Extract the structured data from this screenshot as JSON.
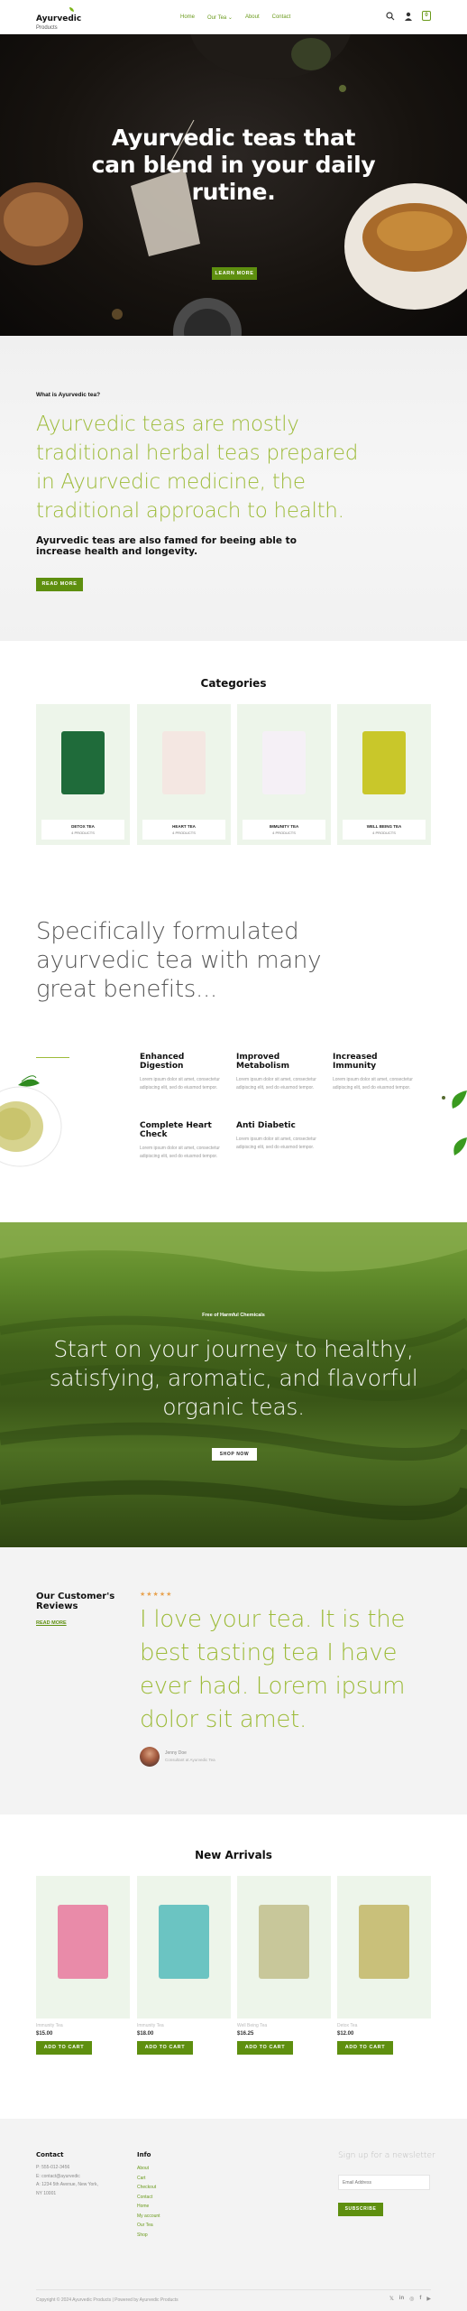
{
  "header": {
    "logo": "Ayurvedic",
    "logo_sub": "Products",
    "nav": [
      "Home",
      "Our Tea ⌄",
      "About",
      "Contact"
    ],
    "cart_count": "0"
  },
  "hero": {
    "title_lines": [
      "Ayurvedic teas that",
      "can blend in your daily",
      "rutine."
    ],
    "cta": "LEARN MORE"
  },
  "about": {
    "kicker": "What is Ayurvedic tea?",
    "headline_lines": [
      "Ayurvedic teas are mostly",
      "traditional herbal teas prepared",
      "in Ayurvedic medicine, the",
      "traditional approach to health."
    ],
    "subtitle_lines": [
      "Ayurvedic teas are also famed for beeing able to",
      "increase health and longevity."
    ],
    "cta": "READ MORE"
  },
  "categories": {
    "title": "Categories",
    "items": [
      {
        "name": "DETOX TEA",
        "count": "4 PRODUCTS",
        "color": "#1f6b3a"
      },
      {
        "name": "HEART TEA",
        "count": "4 PRODUCTS",
        "color": "#f4e7e2"
      },
      {
        "name": "IMMUNITY TEA",
        "count": "4 PRODUCTS",
        "color": "#f5f0f6"
      },
      {
        "name": "WELL BEING TEA",
        "count": "4 PRODUCTS",
        "color": "#c9c72a"
      }
    ]
  },
  "benefits": {
    "title_lines": [
      "Specifically formulated",
      "ayurvedic tea with many",
      "great benefits..."
    ],
    "items": [
      {
        "title": "Enhanced Digestion",
        "text": "Lorem ipsum dolor sit amet, consectetur adipiscing elit, sed do eiusmod tempor."
      },
      {
        "title": "Improved Metabolism",
        "text": "Lorem ipsum dolor sit amet, consectetur adipiscing elit, sed do eiusmod tempor."
      },
      {
        "title": "Increased Immunity",
        "text": "Lorem ipsum dolor sit amet, consectetur adipiscing elit, sed do eiusmod tempor."
      },
      {
        "title": "Complete Heart Check",
        "text": "Lorem ipsum dolor sit amet, consectetur adipiscing elit, sed do eiusmod tempor."
      },
      {
        "title": "Anti Diabetic",
        "text": "Lorem ipsum dolor sit amet, consectetur adipiscing elit, sed do eiusmod tempor."
      }
    ]
  },
  "journey": {
    "kicker": "Free of Harmful Chemicals",
    "title_lines": [
      "Start on your journey to healthy,",
      "satisfying, aromatic, and flavorful",
      "organic teas."
    ],
    "cta": "SHOP NOW"
  },
  "testimonial": {
    "section_title_lines": [
      "Our Customer's",
      "Reviews"
    ],
    "more_link": "READ MORE",
    "stars": "★★★★★",
    "quote_lines": [
      "I love your tea. It is the",
      "best tasting tea I have",
      "ever had. Lorem ipsum",
      "dolor sit amet."
    ],
    "name": "Jenny Doe",
    "role": "Consultant at Ayurvedic Tea"
  },
  "arrivals": {
    "title": "New Arrivals",
    "items": [
      {
        "category": "Immunity Tea",
        "price": "$15.00",
        "cta": "ADD TO CART",
        "color": "#e98ba9"
      },
      {
        "category": "Immunity Tea",
        "price": "$18.00",
        "cta": "ADD TO CART",
        "color": "#6bc4c2"
      },
      {
        "category": "Well Being Tea",
        "price": "$16.25",
        "cta": "ADD TO CART",
        "color": "#c8c79a"
      },
      {
        "category": "Detox Tea",
        "price": "$12.00",
        "cta": "ADD TO CART",
        "color": "#c9c07a"
      }
    ]
  },
  "footer": {
    "contact_title": "Contact",
    "contact_lines": [
      "P: 555-012-3456",
      "E: contact@ayurvedic",
      "A: 1234 5th Avenue, New York,",
      "NY 10001"
    ],
    "info_title": "Info",
    "info_links": [
      "About",
      "Cart",
      "Checkout",
      "Contact",
      "Home",
      "My account",
      "Our Tea",
      "Shop"
    ],
    "newsletter_title": "Sign up for a newsletter",
    "email_placeholder": "Email Address",
    "subscribe": "SUBSCRIBE",
    "copyright": "Copyright © 2024 Ayurvedic Products | Powered by Ayurvedic Products",
    "social": [
      "𝕏",
      "in",
      "◎",
      "f",
      "▶"
    ]
  },
  "colors": {
    "accent": "#5e8f0f",
    "headline_green": "#9dbb39",
    "card_bg": "#edf5ea",
    "star": "#e8a24f"
  }
}
